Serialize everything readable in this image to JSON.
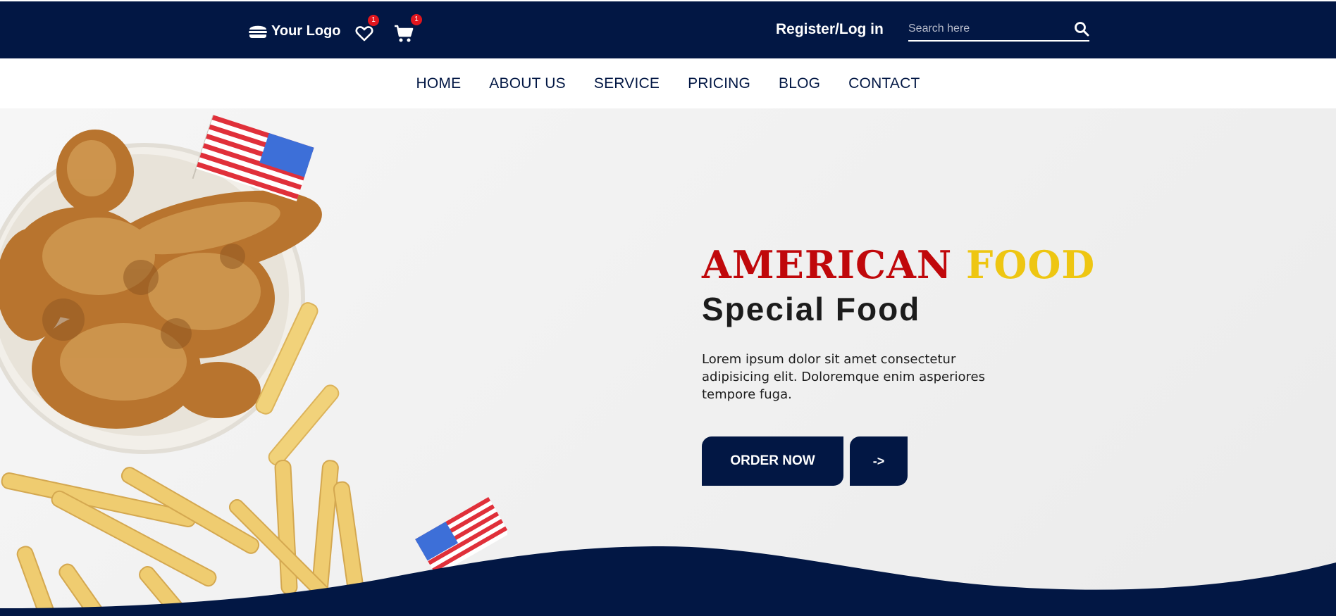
{
  "header": {
    "logo_text": "Your Logo",
    "wishlist_count": "1",
    "cart_count": "1",
    "register_label": "Register/Log in",
    "search_placeholder": "Search here"
  },
  "nav": {
    "items": [
      "HOME",
      "ABOUT US",
      "SERVICE",
      "PRICING",
      "BLOG",
      "CONTACT"
    ]
  },
  "hero": {
    "headline_part1": "AMERICAN",
    "headline_part2": "FOOD",
    "subheadline": "Special Food",
    "description": "Lorem ipsum dolor sit amet consectetur adipisicing elit. Doloremque enim asperiores tempore fuga.",
    "order_button": "ORDER NOW",
    "arrow_button": "->"
  },
  "colors": {
    "navy": "#021744",
    "red": "#c0080b",
    "yellow": "#eec612",
    "badge": "#e1161e"
  }
}
